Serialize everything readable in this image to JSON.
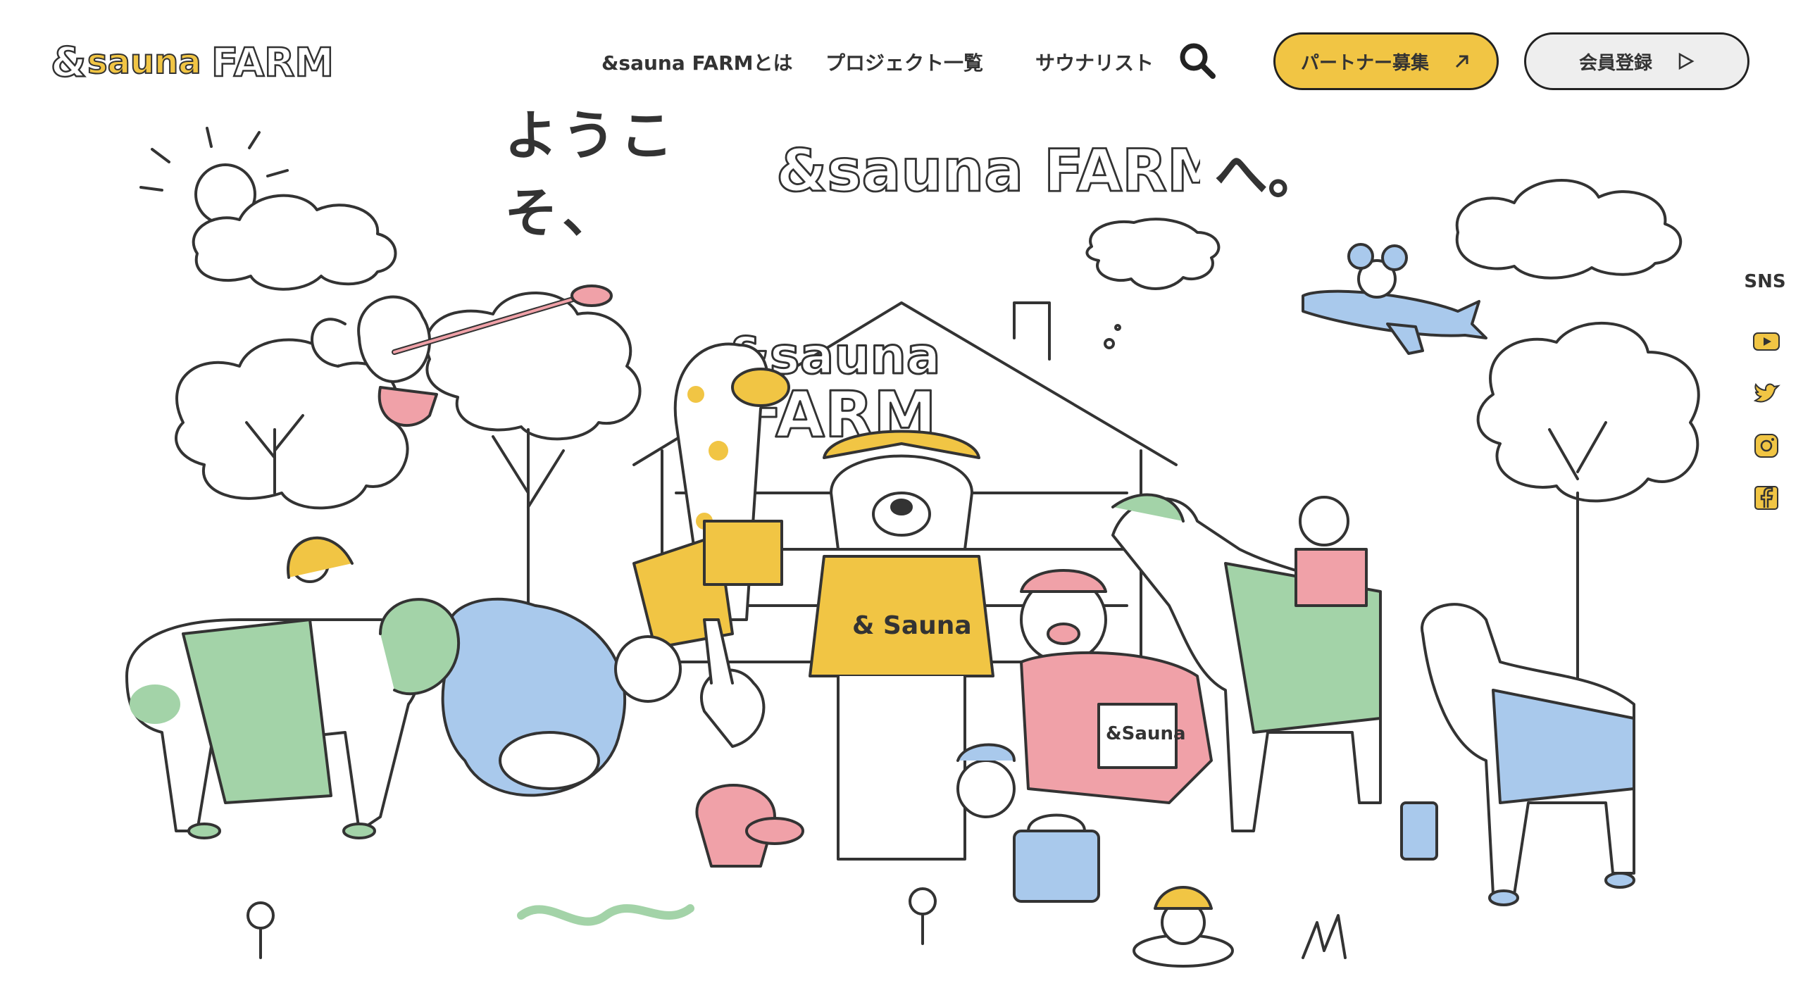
{
  "header": {
    "logo": {
      "brand_amp": "&",
      "brand_sauna": "sauna",
      "brand_farm": "FARM"
    },
    "nav": [
      {
        "label": "&sauna FARMとは"
      },
      {
        "label": "プロジェクト一覧"
      },
      {
        "label": "サウナリスト"
      }
    ],
    "search_icon": "search-icon",
    "partner_button": {
      "label": "パートナー募集",
      "icon": "external-arrow-icon"
    },
    "member_button": {
      "label": "会員登録",
      "icon": "play-triangle-icon"
    }
  },
  "hero": {
    "title_prefix": "ようこそ、",
    "title_brand": "&sauna FARM",
    "title_suffix": "へ。",
    "sign_line1": "&sauna",
    "sign_line2": "FARM",
    "bear_shirt": "& Sauna",
    "bag_label": "&Sauna"
  },
  "sns": {
    "label": "SNS",
    "icons": [
      "youtube-icon",
      "twitter-icon",
      "instagram-icon",
      "facebook-icon"
    ]
  },
  "colors": {
    "accent_yellow": "#f1c544",
    "green": "#a3d3a8",
    "blue": "#a9c9ec",
    "pink": "#f0a1a8",
    "line": "#333333"
  }
}
